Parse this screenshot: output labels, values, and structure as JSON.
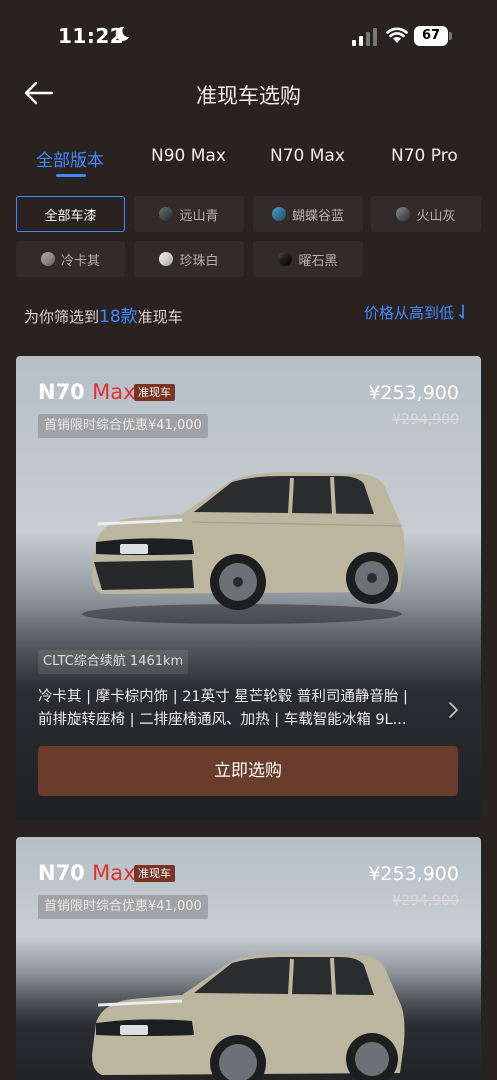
{
  "status_bar": {
    "time": "11:22",
    "battery": "67"
  },
  "nav": {
    "title": "准现车选购"
  },
  "tabs": [
    "全部版本",
    "N90 Max",
    "N70 Max",
    "N70 Pro"
  ],
  "active_tab": "全部版本",
  "colors": [
    {
      "label": "全部车漆",
      "swatch": "",
      "active": true
    },
    {
      "label": "远山青",
      "swatch": "#4d5559",
      "active": false
    },
    {
      "label": "蝴蝶谷蓝",
      "swatch": "#2e6f8f",
      "active": false
    },
    {
      "label": "火山灰",
      "swatch": "#54575a",
      "active": false
    },
    {
      "label": "冷卡其",
      "swatch": "#8b8578",
      "active": false
    },
    {
      "label": "珍珠白",
      "swatch": "#c9c9c9",
      "active": false
    },
    {
      "label": "曜石黑",
      "swatch": "#111111",
      "active": false
    }
  ],
  "filter": {
    "prefix": "为你筛选到",
    "count": "18款",
    "suffix": "准现车",
    "sort_label": "价格从高到低"
  },
  "cards": [
    {
      "model": "N70",
      "suffix": "Max",
      "badge": "准现车",
      "price": "¥253,900",
      "original_price": "¥294,900",
      "promo": "首销限时综合优惠¥41,000",
      "range": "CLTC综合续航 1461km",
      "specs": [
        "冷卡其 | 摩卡棕内饰 | 21英寸 星芒轮毂 普利司通静音胎 |",
        "前排旋转座椅 | 二排座椅通风、加热 | 车载智能冰箱 9L..."
      ],
      "button": "立即选购"
    },
    {
      "model": "N70",
      "suffix": "Max",
      "badge": "准现车",
      "price": "¥253,900",
      "original_price": "¥294,900",
      "promo": "首销限时综合优惠¥41,000"
    }
  ],
  "theme": {
    "accent": "#3d8bff",
    "background": "#2a2121",
    "brand_red": "#e1322f",
    "button": "#6a3c2c"
  }
}
